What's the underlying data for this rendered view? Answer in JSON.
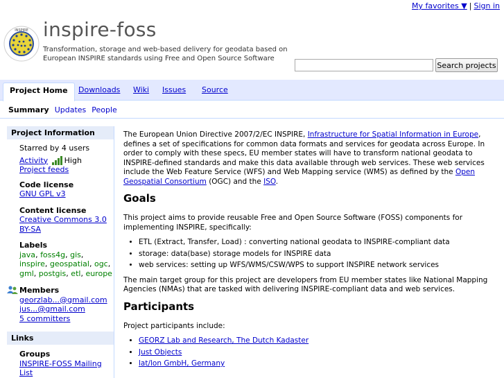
{
  "topbar": {
    "favorites": "My favorites ▼",
    "separator": "|",
    "signin": "Sign in"
  },
  "header": {
    "name": "inspire-foss",
    "summary": "Transformation, storage and web-based delivery for geodata based on European INSPIRE standards using Free and Open Source Software",
    "logo_text": "INSPIRE"
  },
  "search": {
    "placeholder": "",
    "button": "Search projects"
  },
  "tabs": [
    {
      "label": "Project Home"
    },
    {
      "label": "Downloads"
    },
    {
      "label": "Wiki"
    },
    {
      "label": "Issues"
    },
    {
      "label": "Source"
    }
  ],
  "subnav": {
    "current": "Summary",
    "items": [
      "Updates",
      "People"
    ]
  },
  "sidebar": {
    "info_title": "Project Information",
    "starred": "Starred by 4 users",
    "activity_label": "Activity",
    "activity_level": "High",
    "project_feeds": "Project feeds",
    "code_license_title": "Code license",
    "code_license": "GNU GPL v3",
    "content_license_title": "Content license",
    "content_license": "Creative Commons 3.0 BY-SA",
    "labels_title": "Labels",
    "labels": [
      "java",
      "foss4g",
      "gis",
      "inspire",
      "geospatial",
      "ogc",
      "gml",
      "postgis",
      "etl",
      "europe"
    ],
    "members_title": "Members",
    "members": [
      "georzlab...@gmail.com",
      "jus...@gmail.com"
    ],
    "committers": "5 committers",
    "links_title": "Links",
    "groups_title": "Groups",
    "group": "INSPIRE-FOSS Mailing List"
  },
  "content": {
    "intro_1": "The European Union Directive 2007/2/EC INSPIRE, ",
    "intro_link_1": "Infrastructure for Spatial Information in Europe",
    "intro_2": ", defines a set of specifications for common data formats and services for geodata across Europe. In order to comply with these specs, EU member states will have to transform national geodata to INSPIRE-defined standards and make this data available through web services. These web services include the Web Feature Service (WFS) and Web Mapping service (WMS) as defined by the ",
    "intro_link_2": "Open Geospatial Consortium",
    "intro_3": " (OGC) and the ",
    "intro_link_3": "ISO",
    "intro_4": ".",
    "goals_title": "Goals",
    "goals_text": "This project aims to provide reusable Free and Open Source Software (FOSS) components for implementing INSPIRE, specifically:",
    "goals_items": [
      "ETL (Extract, Transfer, Load) : converting national geodata to INSPIRE-compliant data",
      "storage: data(base) storage models for INSPIRE data",
      "web services: setting up WFS/WMS/CSW/WPS to support INSPIRE network services"
    ],
    "target_text": "The main target group for this project are developers from EU member states like National Mapping Agencies (NMAs) that are tasked with delivering INSPIRE-compliant data and web services.",
    "participants_title": "Participants",
    "participants_text": "Project participants include:",
    "participants": [
      "GEORZ Lab and Research, The Dutch Kadaster",
      "Just Objects",
      "lat/lon GmbH, Germany"
    ]
  },
  "colors": {
    "link": "#0000cc",
    "label": "#008000",
    "nav_bg": "#e3e9ff",
    "side_head_bg": "#e5ecf9",
    "activity_bar": "#3b8a26"
  }
}
